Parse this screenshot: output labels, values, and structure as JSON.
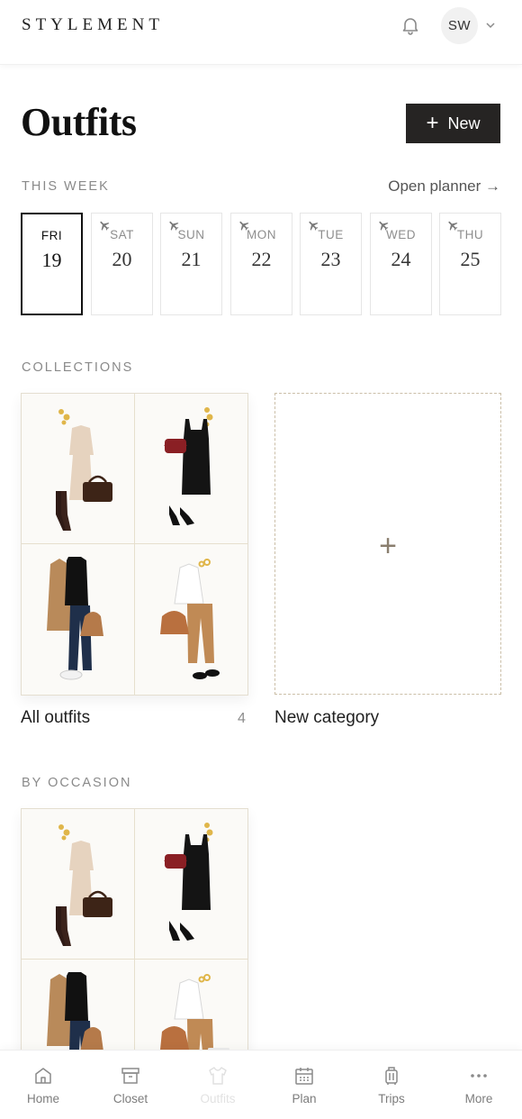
{
  "header": {
    "brand": "STYLEMENT",
    "avatar_initials": "SW"
  },
  "page": {
    "title": "Outfits",
    "new_button_plus": "+",
    "new_button_label": "New"
  },
  "week": {
    "section_label": "THIS WEEK",
    "planner_link": "Open planner →",
    "days": [
      {
        "name": "FRI",
        "num": "19",
        "selected": true,
        "travel": false
      },
      {
        "name": "SAT",
        "num": "20",
        "selected": false,
        "travel": true
      },
      {
        "name": "SUN",
        "num": "21",
        "selected": false,
        "travel": true
      },
      {
        "name": "MON",
        "num": "22",
        "selected": false,
        "travel": true
      },
      {
        "name": "TUE",
        "num": "23",
        "selected": false,
        "travel": true
      },
      {
        "name": "WED",
        "num": "24",
        "selected": false,
        "travel": true
      },
      {
        "name": "THU",
        "num": "25",
        "selected": false,
        "travel": true
      }
    ]
  },
  "collections": {
    "section_label": "COLLECTIONS",
    "all_outfits": {
      "label": "All outfits",
      "count": "4"
    },
    "new_category": {
      "label": "New category",
      "plus": "+"
    }
  },
  "occasion": {
    "section_label": "BY OCCASION"
  },
  "nav": {
    "items": [
      {
        "label": "Home",
        "icon": "home-icon"
      },
      {
        "label": "Closet",
        "icon": "closet-icon"
      },
      {
        "label": "Outfits",
        "icon": "outfits-icon",
        "active": true
      },
      {
        "label": "Plan",
        "icon": "calendar-icon"
      },
      {
        "label": "Trips",
        "icon": "luggage-icon"
      },
      {
        "label": "More",
        "icon": "more-icon"
      }
    ]
  },
  "colors": {
    "accent_dark": "#262423",
    "camel": "#b98a5a",
    "beige": "#e6d3bf",
    "gold": "#e0b64a",
    "burgundy": "#8a1f24"
  }
}
